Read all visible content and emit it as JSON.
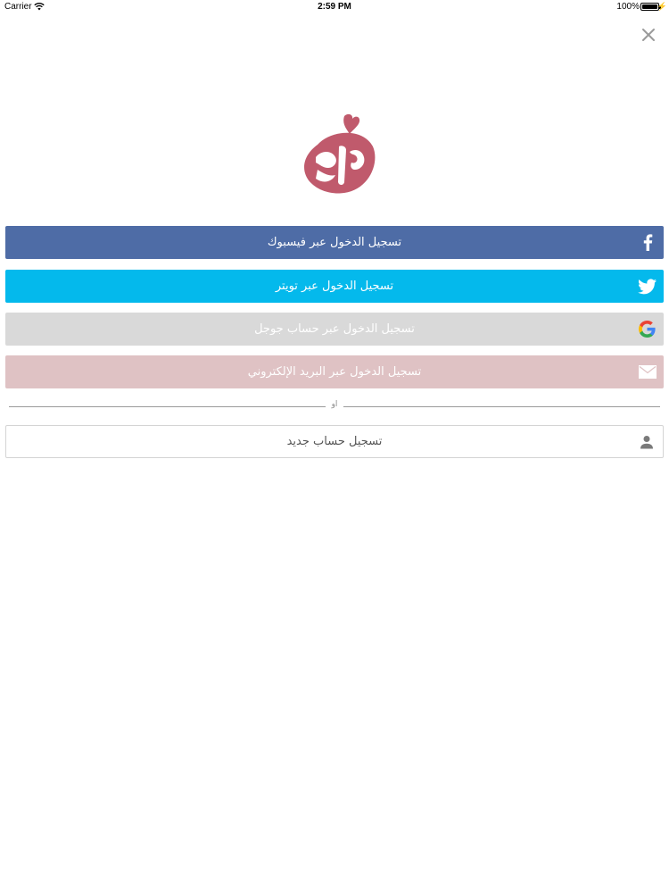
{
  "status_bar": {
    "carrier": "Carrier",
    "time": "2:59 PM",
    "battery": "100%"
  },
  "icons": {
    "close": "close-icon",
    "logo": "brand-logo",
    "facebook": "facebook-icon",
    "twitter": "twitter-icon",
    "google": "google-icon",
    "email": "mail-icon",
    "register": "person-icon"
  },
  "login": {
    "facebook_label": "تسجيل الدخول عبر فيسبوك",
    "twitter_label": "تسجيل الدخول عبر تويتر",
    "google_label": "تسجيل الدخول عبر حساب جوجل",
    "email_label": "تسجيل الدخول عبر البريد الإلكتروني"
  },
  "divider": {
    "or_label": "او"
  },
  "register": {
    "label": "تسجيل حساب جديد"
  },
  "colors": {
    "facebook": "#4e6ca6",
    "twitter": "#04b9ec",
    "google": "#d9d9d9",
    "email": "#dfc2c4",
    "logo": "#c05a6c"
  }
}
